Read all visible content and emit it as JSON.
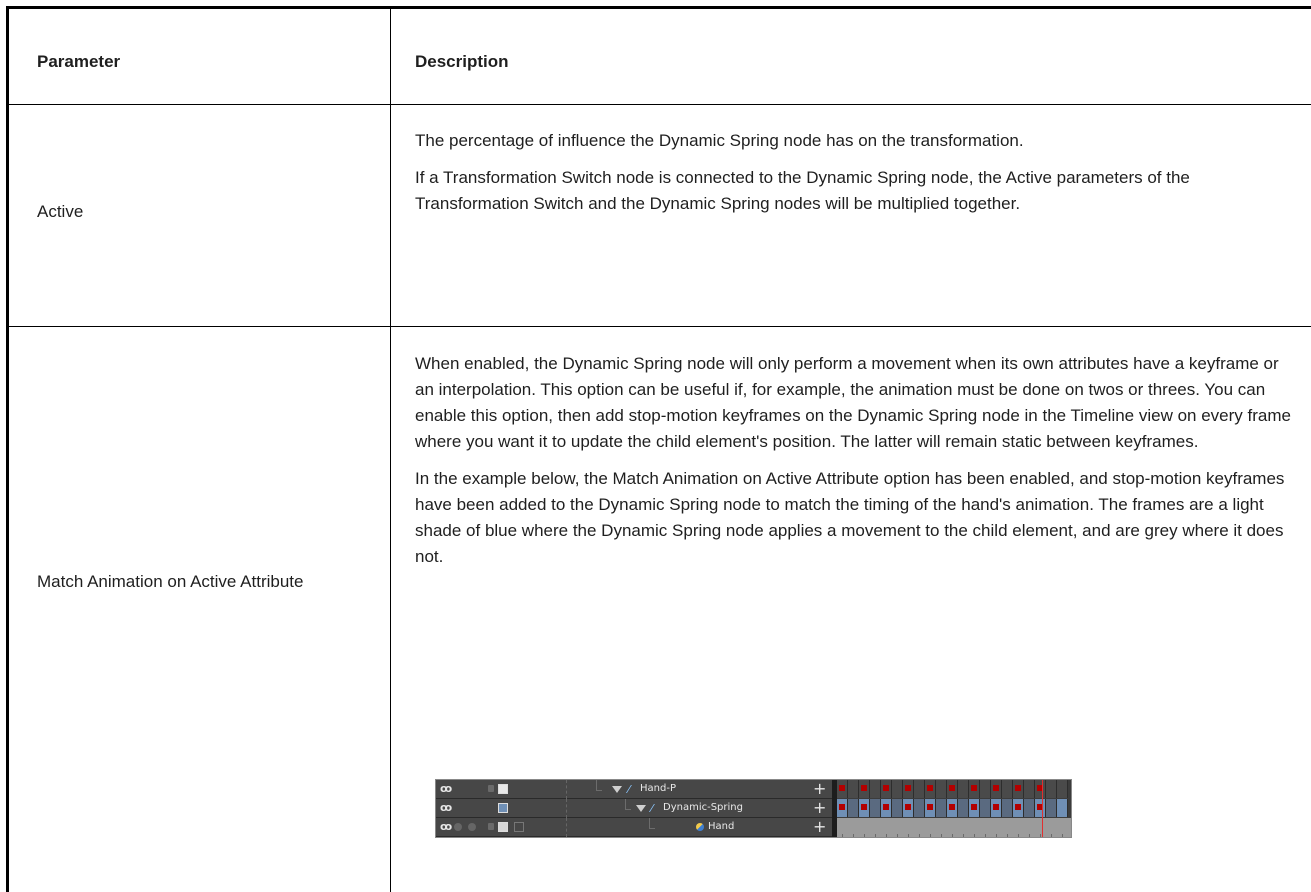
{
  "table": {
    "headers": {
      "parameter": "Parameter",
      "description": "Description"
    },
    "rows": [
      {
        "parameter": "Active",
        "description": [
          "The percentage of influence the Dynamic Spring node has on the transformation.",
          "If a Transformation Switch node is connected to the Dynamic Spring node, the Active parameters of the Transformation Switch and the Dynamic Spring nodes will be multiplied together."
        ]
      },
      {
        "parameter": "Match Animation on Active Attribute",
        "description": [
          "When enabled, the Dynamic Spring node will only perform a movement when its own attributes have a keyframe or an interpolation. This option can be useful if, for example, the animation must be done on twos or threes. You can enable this option, then add stop-motion keyframes on the Dynamic Spring node in the Timeline view on every frame where you want it to update the child element's position. The latter will remain static between keyframes.",
          "In the example below, the Match Animation on Active Attribute option has been enabled, and stop-motion keyframes have been added to the Dynamic Spring node to match the timing of the hand's animation. The frames are a light shade of blue where the Dynamic Spring node applies a movement to the child element, and are grey where it does not."
        ]
      }
    ]
  },
  "timeline_example": {
    "layers": [
      {
        "name": "Hand-P",
        "icon": "curve-icon"
      },
      {
        "name": "Dynamic-Spring",
        "icon": "curve-icon"
      },
      {
        "name": "Hand",
        "icon": "drawing-icon"
      }
    ],
    "colors": {
      "keyframe": "#b40000",
      "active_frame": "#6f8fb5",
      "inactive_frame": "#9b9b9b",
      "playhead": "#e03030"
    }
  }
}
